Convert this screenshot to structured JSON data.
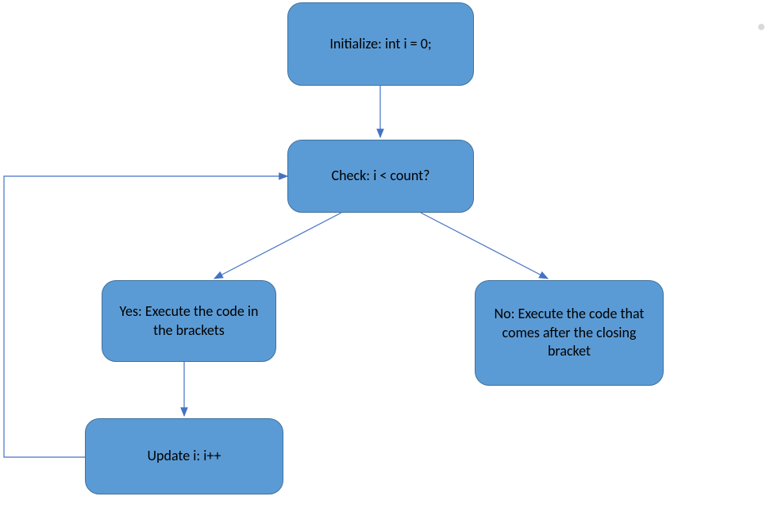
{
  "diagram": {
    "type": "flowchart",
    "topic": "For-loop control flow",
    "nodes": {
      "initialize": {
        "label": "Initialize: int i = 0;"
      },
      "check": {
        "label": "Check: i < count?"
      },
      "yes": {
        "label": "Yes: Execute the code in the brackets"
      },
      "no": {
        "label": "No: Execute the code that comes after the closing bracket"
      },
      "update": {
        "label": "Update  i: i++"
      }
    },
    "edges": [
      {
        "from": "initialize",
        "to": "check"
      },
      {
        "from": "check",
        "to": "yes"
      },
      {
        "from": "check",
        "to": "no"
      },
      {
        "from": "yes",
        "to": "update"
      },
      {
        "from": "update",
        "to": "check"
      }
    ]
  }
}
